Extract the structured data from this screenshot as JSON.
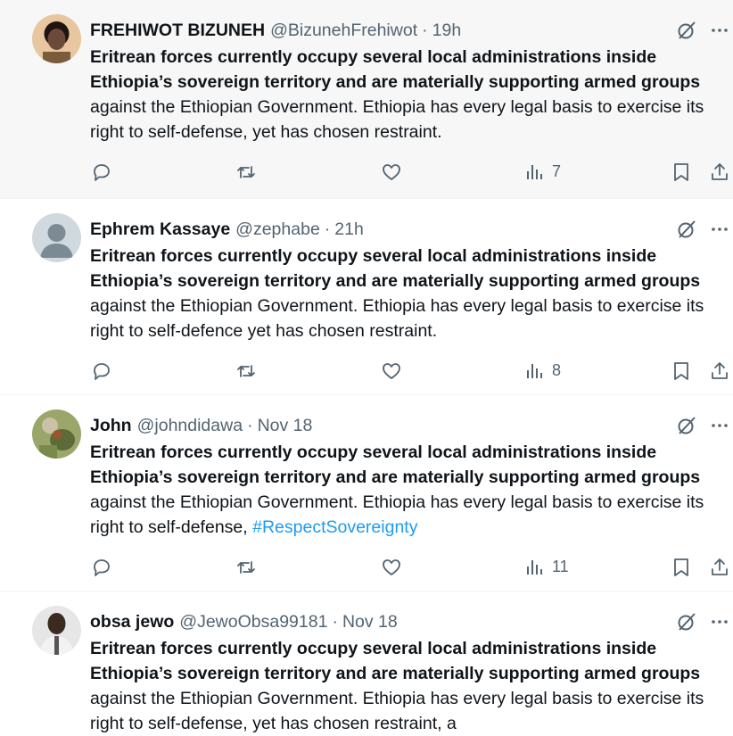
{
  "tweets": [
    {
      "name": "FREHIWOT BIZUNEH",
      "handle": "@BizunehFrehiwot",
      "separator": "·",
      "time": "19h",
      "text_bold": "Eritrean forces currently occupy several local administrations inside Ethiopia’s sovereign territory and are materially supporting armed groups",
      "text_rest": " against the Ethiopian Government. Ethiopia has every legal basis to exercise its right to self-defense, yet has chosen restraint.",
      "hashtag": "",
      "views": "7",
      "avatar_color": "#6b4a3a"
    },
    {
      "name": "Ephrem Kassaye",
      "handle": "@zephabe",
      "separator": "·",
      "time": "21h",
      "text_bold": "Eritrean forces currently occupy several local administrations inside Ethiopia’s sovereign territory and are materially supporting armed groups",
      "text_rest": " against the Ethiopian Government. Ethiopia has every legal basis to exercise its right to self-defence yet has chosen restraint.",
      "hashtag": "",
      "views": "8",
      "avatar_color": "#c4cfd6"
    },
    {
      "name": "John",
      "handle": "@johndidawa",
      "separator": "·",
      "time": "Nov 18",
      "text_bold": "Eritrean forces currently occupy several local administrations inside Ethiopia’s sovereign territory and are materially supporting armed groups",
      "text_rest": " against the Ethiopian Government. Ethiopia has every legal basis to exercise its right to self-defense, ",
      "hashtag": "#RespectSovereignty",
      "views": "11",
      "avatar_color": "#7a8a4a"
    },
    {
      "name": "obsa jewo",
      "handle": "@JewoObsa99181",
      "separator": "·",
      "time": "Nov 18",
      "text_bold": "Eritrean forces currently occupy several local administrations inside Ethiopia’s sovereign territory and are materially supporting armed groups",
      "text_rest": " against the Ethiopian Government. Ethiopia has every legal basis to exercise its right to self-defense, yet has chosen restraint, a",
      "hashtag": "",
      "views": "",
      "avatar_color": "#3a3a3a"
    }
  ],
  "colors": {
    "text_primary": "#0f1419",
    "text_secondary": "#536471",
    "link": "#1d9bf0",
    "highlight_bg": "#f7f7f7",
    "divider": "#eff3f4"
  },
  "icons": [
    "grok-icon",
    "more-icon",
    "reply-icon",
    "repost-icon",
    "like-icon",
    "views-icon",
    "bookmark-icon",
    "share-icon"
  ]
}
